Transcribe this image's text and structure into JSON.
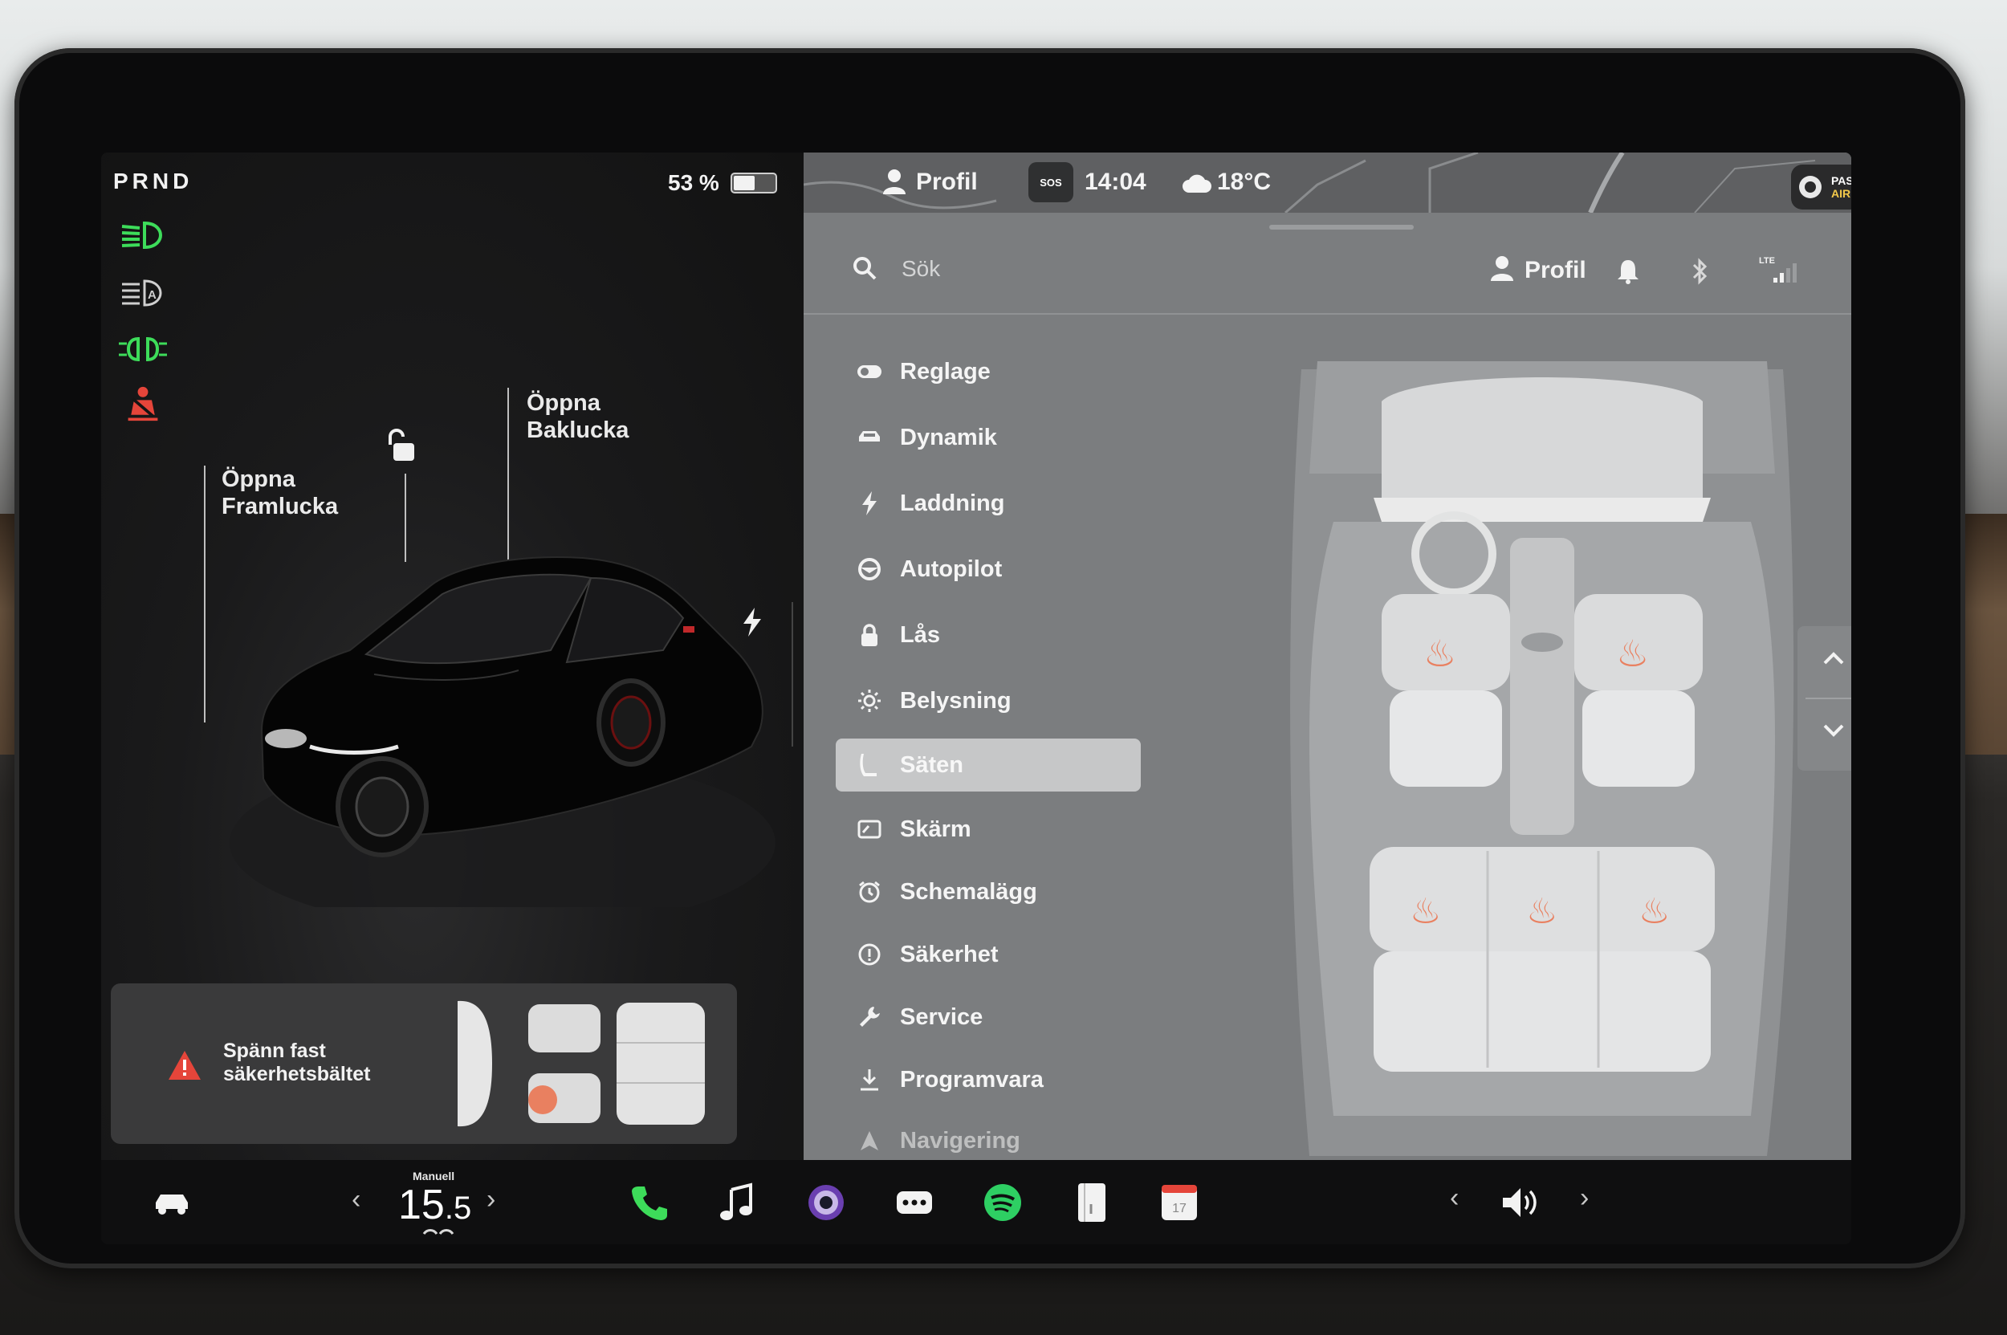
{
  "status": {
    "gear": "PRND",
    "battery_percent": "53 %",
    "battery_level": 0.53,
    "profile": "Profil",
    "time": "14:04",
    "temperature": "18°C",
    "sos": "SOS",
    "airbag_line1": "PASSENGER",
    "airbag_line2": "AIRBAG ON"
  },
  "car_panel": {
    "frunk_label_1": "Öppna",
    "frunk_label_2": "Framlucka",
    "trunk_label_1": "Öppna",
    "trunk_label_2": "Baklucka",
    "alert_line1": "Spänn fast",
    "alert_line2": "säkerhetsbältet"
  },
  "search": {
    "placeholder": "Sök",
    "profile_label": "Profil"
  },
  "menu": {
    "items": [
      {
        "label": "Reglage",
        "icon": "toggle-icon"
      },
      {
        "label": "Dynamik",
        "icon": "car-icon"
      },
      {
        "label": "Laddning",
        "icon": "bolt-icon"
      },
      {
        "label": "Autopilot",
        "icon": "steering-wheel-icon"
      },
      {
        "label": "Lås",
        "icon": "lock-icon"
      },
      {
        "label": "Belysning",
        "icon": "sun-icon"
      },
      {
        "label": "Säten",
        "icon": "seat-icon"
      },
      {
        "label": "Skärm",
        "icon": "display-icon"
      },
      {
        "label": "Schemalägg",
        "icon": "alarm-icon"
      },
      {
        "label": "Säkerhet",
        "icon": "info-circle-icon"
      },
      {
        "label": "Service",
        "icon": "wrench-icon"
      },
      {
        "label": "Programvara",
        "icon": "download-icon"
      },
      {
        "label": "Navigering",
        "icon": "navigation-icon"
      }
    ],
    "active": "Säten"
  },
  "climate": {
    "mode": "Manuell",
    "temp_whole": "15",
    "temp_decimal": ".5"
  },
  "colors": {
    "indicator_green": "#3ddc5a",
    "alert_red": "#e5453a",
    "heat_orange": "#e98060"
  }
}
